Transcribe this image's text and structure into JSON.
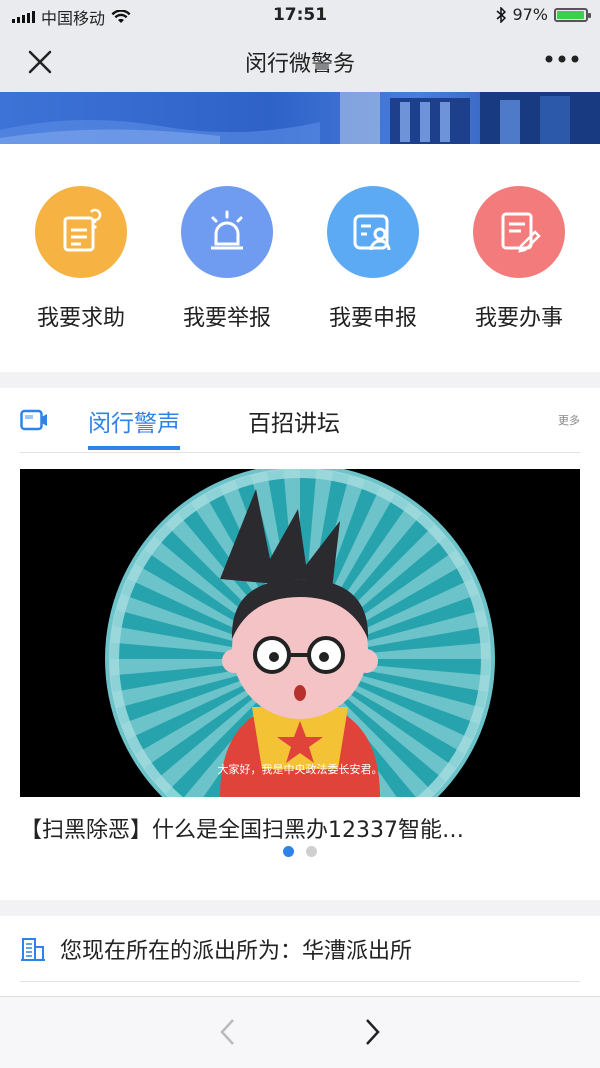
{
  "status_bar": {
    "carrier": "中国移动",
    "time": "17:51",
    "battery_percent": "97%",
    "battery_level": 0.97,
    "icons": [
      "signal-icon",
      "wifi-icon",
      "bluetooth-icon",
      "battery-icon"
    ]
  },
  "nav": {
    "title": "闵行微警务",
    "close_icon": "close-icon",
    "more_icon": "more-dots-icon"
  },
  "services": [
    {
      "label": "我要求助",
      "icon": "help-document-icon",
      "color": "#f6b343"
    },
    {
      "label": "我要举报",
      "icon": "alarm-light-icon",
      "color": "#6f9cf0"
    },
    {
      "label": "我要申报",
      "icon": "id-card-person-icon",
      "color": "#5daaf4"
    },
    {
      "label": "我要办事",
      "icon": "edit-form-icon",
      "color": "#f47b7b"
    }
  ],
  "news": {
    "tabs": [
      {
        "label": "闵行警声",
        "active": true
      },
      {
        "label": "百招讲坛",
        "active": false
      }
    ],
    "more_label": "更多",
    "video_subtitle": "大家好，我是中央政法委长安君。",
    "video_title": "【扫黑除恶】什么是全国扫黑办12337智能…",
    "pagination": {
      "total": 2,
      "current": 1
    }
  },
  "station": {
    "text": "您现在所在的派出所为：华漕派出所",
    "icon": "building-icon"
  },
  "bottom_nav": {
    "back_icon": "chevron-left-icon",
    "forward_icon": "chevron-right-icon"
  },
  "colors": {
    "accent": "#2f82e6",
    "nav_bg": "#e9ebee"
  }
}
